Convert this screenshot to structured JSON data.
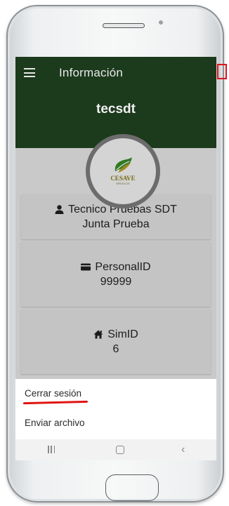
{
  "appbar": {
    "title": "Información"
  },
  "header": {
    "username": "tecsdt"
  },
  "logo": {
    "name": "CESAVE",
    "subtitle": "SINALOA"
  },
  "cards": {
    "user": {
      "name": "Tecnico Pruebas SDT",
      "board": "Junta Prueba"
    },
    "personal": {
      "label": "PersonalID",
      "value": "99999"
    },
    "sim": {
      "label": "SimID",
      "value": "6"
    }
  },
  "menu": {
    "logout": "Cerrar sesión",
    "send_file": "Enviar archivo"
  },
  "icons": {
    "menu": "hamburger-menu-icon",
    "overflow": "more-vert-icon",
    "user": "person-icon",
    "personal_id": "id-card-icon",
    "sim": "home-icon",
    "nav_recents": "recents-icon",
    "nav_home": "home-nav-icon",
    "nav_back": "back-icon"
  },
  "colors": {
    "appbar": "#1c3a1c",
    "card": "#c4c4c4",
    "highlight": "#e0141b"
  }
}
